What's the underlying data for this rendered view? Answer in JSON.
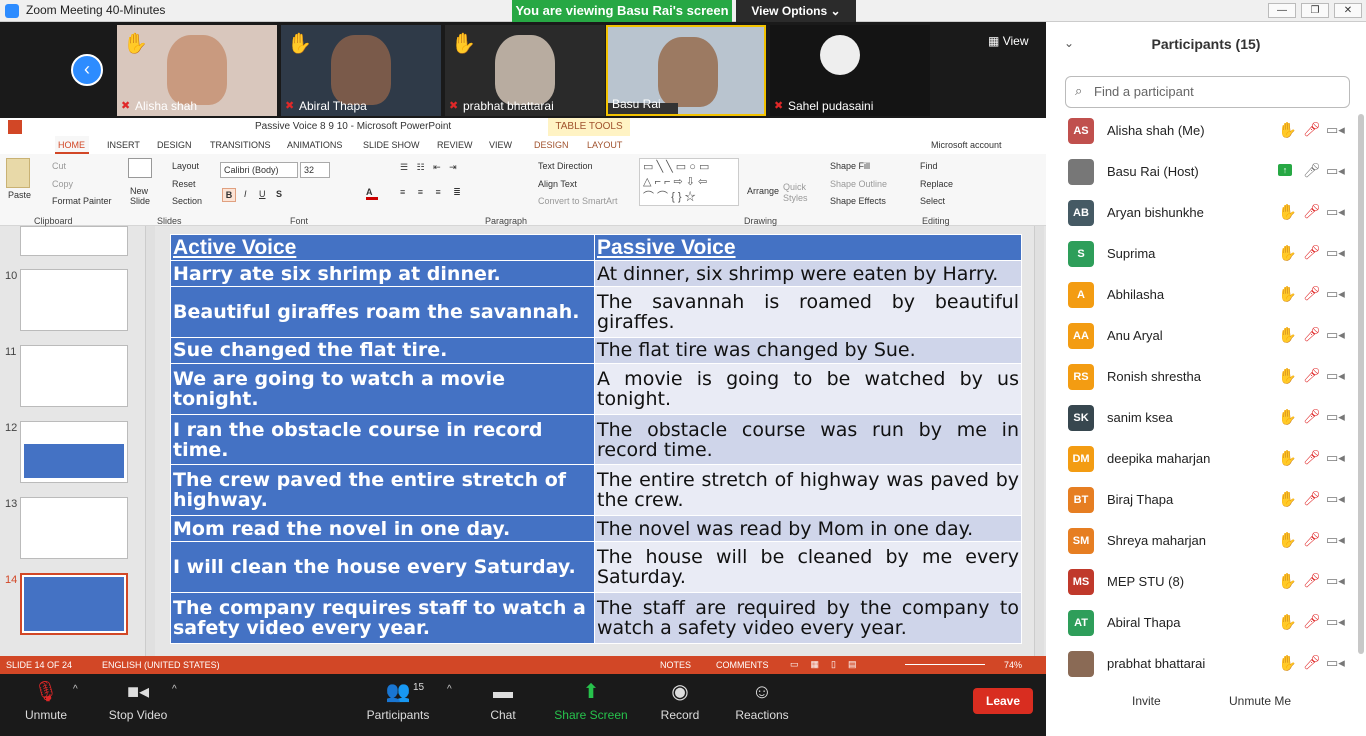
{
  "window": {
    "title": "Zoom Meeting 40-Minutes"
  },
  "share_banner": "You are viewing Basu Rai's screen",
  "view_options": "View Options",
  "view_button": "View",
  "videos": [
    {
      "name": "Alisha shah",
      "hand": true
    },
    {
      "name": "Abiral Thapa",
      "hand": true
    },
    {
      "name": "prabhat bhattarai",
      "hand": true
    },
    {
      "name": "Basu Rai",
      "hand": false
    },
    {
      "name": "Sahel pudasaini",
      "hand": false
    }
  ],
  "ppt": {
    "title": "Passive Voice 8 9 10 - Microsoft PowerPoint",
    "table_tools": "TABLE TOOLS",
    "tabs": [
      "HOME",
      "INSERT",
      "DESIGN",
      "TRANSITIONS",
      "ANIMATIONS",
      "SLIDE SHOW",
      "REVIEW",
      "VIEW",
      "DESIGN",
      "LAYOUT"
    ],
    "account": "Microsoft account",
    "ribbon": {
      "paste": "Paste",
      "cut": "Cut",
      "copy": "Copy",
      "format_painter": "Format Painter",
      "clipboard": "Clipboard",
      "new_slide": "New Slide",
      "layout": "Layout",
      "reset": "Reset",
      "section": "Section",
      "slides": "Slides",
      "font_name": "Calibri (Body)",
      "font_size": "32",
      "font": "Font",
      "paragraph": "Paragraph",
      "text_direction": "Text Direction",
      "align_text": "Align Text",
      "convert_smartart": "Convert to SmartArt",
      "arrange": "Arrange",
      "quick_styles": "Quick Styles",
      "shape_fill": "Shape Fill",
      "shape_outline": "Shape Outline",
      "shape_effects": "Shape Effects",
      "drawing": "Drawing",
      "find": "Find",
      "replace": "Replace",
      "select": "Select",
      "editing": "Editing"
    },
    "thumb_numbers": [
      "10",
      "11",
      "12",
      "13",
      "14"
    ],
    "table_header": {
      "left": "Active Voice",
      "right": "Passive Voice"
    },
    "rows": [
      {
        "active": "Harry ate six shrimp at dinner.",
        "passive": "At dinner, six shrimp were eaten by Harry."
      },
      {
        "active": "Beautiful giraffes roam the savannah.",
        "passive": "The savannah is roamed by beautiful giraffes."
      },
      {
        "active": "Sue changed the flat tire.",
        "passive": "The flat tire was changed by Sue."
      },
      {
        "active": "We are going to watch a movie tonight.",
        "passive": "A movie is going to be watched by us tonight."
      },
      {
        "active": "I ran the obstacle course in record time.",
        "passive": "The obstacle course was run by me in record time."
      },
      {
        "active": "The crew paved the entire stretch of highway.",
        "passive": "The entire stretch of highway was paved by the crew."
      },
      {
        "active": "Mom read the novel in one day.",
        "passive": "The novel was read by Mom in one day."
      },
      {
        "active": "I will clean the house every Saturday.",
        "passive": "The house will be cleaned by me every Saturday."
      },
      {
        "active": "The company requires staff to watch a safety video every year.",
        "passive": "The staff are required by the company to watch a safety video every year."
      }
    ],
    "status": {
      "slide": "SLIDE 14 OF 24",
      "language": "ENGLISH (UNITED STATES)",
      "notes": "NOTES",
      "comments": "COMMENTS",
      "zoom": "74%"
    }
  },
  "toolbar": {
    "unmute": "Unmute",
    "stop_video": "Stop Video",
    "participants": "Participants",
    "participants_count": "15",
    "chat": "Chat",
    "share_screen": "Share Screen",
    "record": "Record",
    "reactions": "Reactions",
    "leave": "Leave"
  },
  "panel": {
    "title": "Participants (15)",
    "search_placeholder": "Find a participant",
    "invite": "Invite",
    "unmute_me": "Unmute Me",
    "participants": [
      {
        "initials": "AS",
        "name": "Alisha shah (Me)",
        "color": "#c0504d",
        "hand": true,
        "muted": true
      },
      {
        "initials": "",
        "name": "Basu Rai (Host)",
        "color": "#777777",
        "hand": false,
        "muted": false,
        "sharing": true
      },
      {
        "initials": "AB",
        "name": "Aryan bishunkhe",
        "color": "#455a64",
        "hand": true,
        "muted": true
      },
      {
        "initials": "S",
        "name": "Suprima",
        "color": "#2e9e5a",
        "hand": true,
        "muted": true
      },
      {
        "initials": "A",
        "name": "Abhilasha",
        "color": "#f39c12",
        "hand": true,
        "muted": true
      },
      {
        "initials": "AA",
        "name": "Anu Aryal",
        "color": "#f39c12",
        "hand": true,
        "muted": true
      },
      {
        "initials": "RS",
        "name": "Ronish shrestha",
        "color": "#f39c12",
        "hand": true,
        "muted": true
      },
      {
        "initials": "SK",
        "name": "sanim ksea",
        "color": "#37474f",
        "hand": true,
        "muted": true
      },
      {
        "initials": "DM",
        "name": "deepika maharjan",
        "color": "#f39c12",
        "hand": true,
        "muted": true
      },
      {
        "initials": "BT",
        "name": "Biraj Thapa",
        "color": "#e67e22",
        "hand": true,
        "muted": true
      },
      {
        "initials": "SM",
        "name": "Shreya maharjan",
        "color": "#e67e22",
        "hand": true,
        "muted": true
      },
      {
        "initials": "MS",
        "name": "MEP STU (8)",
        "color": "#c0392b",
        "hand": true,
        "muted": true
      },
      {
        "initials": "AT",
        "name": "Abiral Thapa",
        "color": "#2e9e5a",
        "hand": true,
        "muted": true
      },
      {
        "initials": "",
        "name": "prabhat bhattarai",
        "color": "#8a6a55",
        "hand": true,
        "muted": true
      }
    ]
  }
}
